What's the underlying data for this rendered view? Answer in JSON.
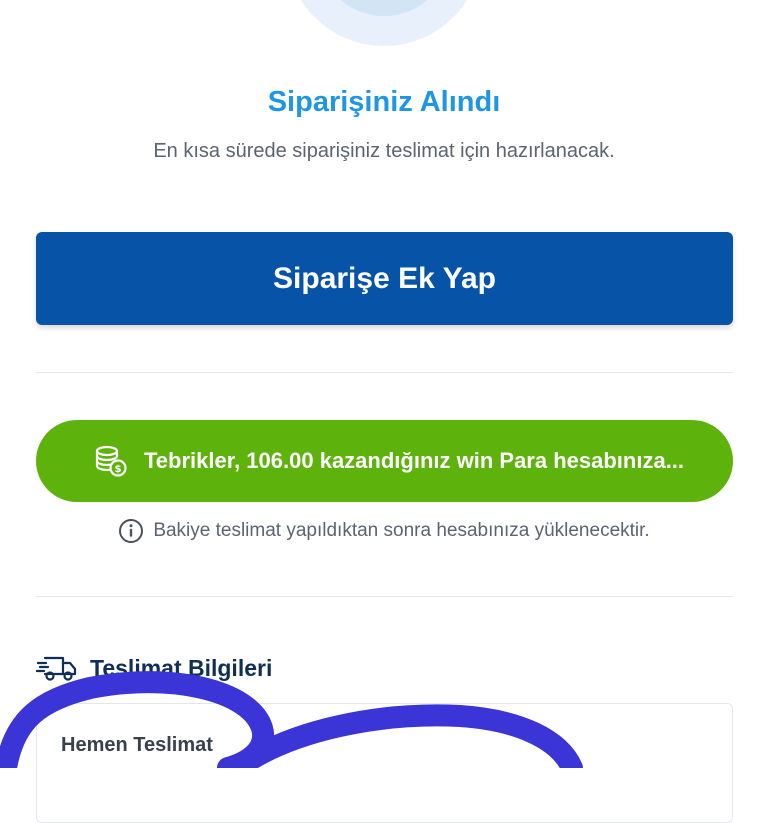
{
  "status": {
    "title": "Siparişiniz Alındı",
    "subtitle": "En kısa sürede siparişiniz teslimat için hazırlanacak."
  },
  "actions": {
    "add_to_order_label": "Siparişe Ek Yap"
  },
  "reward": {
    "text": "Tebrikler, 106.00 kazandığınız win Para hesabınıza...",
    "color": "#5db30b"
  },
  "info": {
    "text": "Bakiye teslimat yapıldıktan sonra hesabınıza yüklenecektir."
  },
  "delivery": {
    "section_title": "Teslimat Bilgileri",
    "type": "Hemen Teslimat"
  },
  "colors": {
    "primary": "#0753a8",
    "title_blue": "#1e96e6",
    "annotation": "#3b34d6"
  },
  "icons": {
    "reward": "coin-stack-icon",
    "info": "info-circle-icon",
    "delivery": "delivery-truck-icon"
  }
}
